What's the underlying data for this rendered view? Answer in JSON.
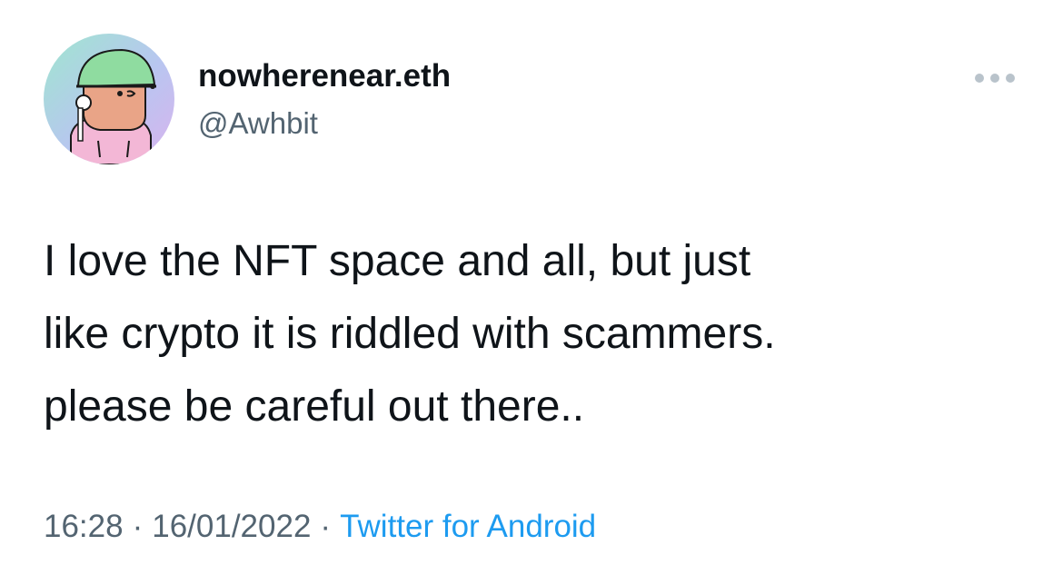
{
  "tweet": {
    "display_name": "nowherenear.eth",
    "handle": "@Awhbit",
    "text_lines": [
      "I love the NFT space and all, but just",
      "like crypto it is riddled with scammers.",
      "please be careful out there.."
    ],
    "time": "16:28",
    "date": "16/01/2022",
    "separator": "·",
    "source": "Twitter for Android"
  },
  "icons": {
    "more": "more-horizontal-icon",
    "avatar": "nft-avatar-image"
  },
  "colors": {
    "text_primary": "#0f1419",
    "text_secondary": "#536471",
    "link": "#1d9bf0",
    "more_icon": "#b9c3cb"
  }
}
